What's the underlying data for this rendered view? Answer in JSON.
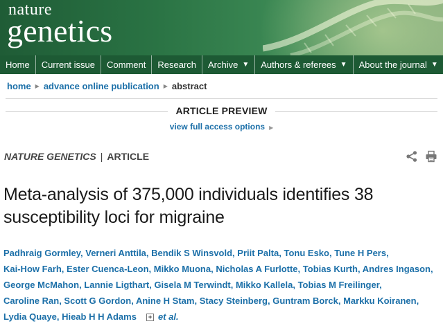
{
  "header": {
    "logo_top": "nature",
    "logo_bottom": "genetics",
    "colors": {
      "masthead": "#2a7344",
      "navbar": "#1d5a34",
      "link": "#1b6fa8"
    }
  },
  "nav": {
    "items": [
      {
        "label": "Home",
        "dropdown": false
      },
      {
        "label": "Current issue",
        "dropdown": false
      },
      {
        "label": "Comment",
        "dropdown": false
      },
      {
        "label": "Research",
        "dropdown": false
      },
      {
        "label": "Archive",
        "dropdown": true
      },
      {
        "label": "Authors & referees",
        "dropdown": true
      },
      {
        "label": "About the journal",
        "dropdown": true
      }
    ],
    "caret": "▼"
  },
  "breadcrumb": {
    "items": [
      "home",
      "advance online publication"
    ],
    "current": "abstract",
    "separator": "▶"
  },
  "preview": {
    "heading": "ARTICLE PREVIEW",
    "access_link": "view full access options",
    "arrow": "▶"
  },
  "journal_line": {
    "journal": "NATURE GENETICS",
    "separator": "|",
    "type": "ARTICLE"
  },
  "icons": {
    "share": "share-icon",
    "print": "print-icon"
  },
  "article": {
    "title": "Meta-analysis of 375,000 individuals identifies 38 susceptibility loci for migraine",
    "authors": [
      "Padhraig Gormley",
      "Verneri Anttila",
      "Bendik S Winsvold",
      "Priit Palta",
      "Tonu Esko",
      "Tune H Pers",
      "Kai-How Farh",
      "Ester Cuenca-Leon",
      "Mikko Muona",
      "Nicholas A Furlotte",
      "Tobias Kurth",
      "Andres Ingason",
      "George McMahon",
      "Lannie Ligthart",
      "Gisela M Terwindt",
      "Mikko Kallela",
      "Tobias M Freilinger",
      "Caroline Ran",
      "Scott G Gordon",
      "Anine H Stam",
      "Stacy Steinberg",
      "Guntram Borck",
      "Markku Koiranen",
      "Lydia Quaye",
      "Hieab H H Adams"
    ],
    "expand_symbol": "+",
    "et_al": "et al."
  }
}
